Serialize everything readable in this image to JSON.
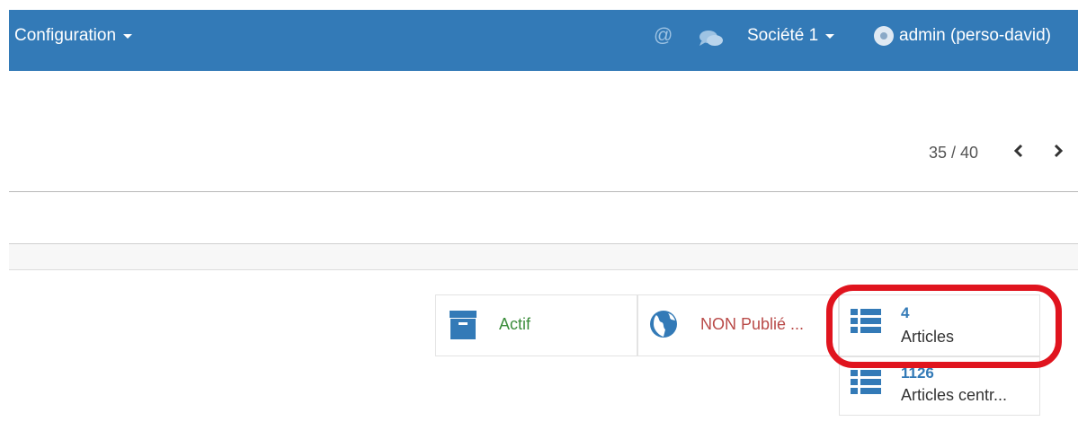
{
  "topbar": {
    "menu_label": "Configuration",
    "mentions_symbol": "@",
    "company_label": "Société 1",
    "user_label": "admin (perso-david)"
  },
  "pager": {
    "text": "35 / 40",
    "prev": "‹",
    "next": "›"
  },
  "buttons": {
    "active": {
      "label": "Actif",
      "color": "#3c8d3c"
    },
    "published": {
      "label": "NON Publié ...",
      "color": "#b94a48"
    },
    "articles": {
      "count": "4",
      "label": "Articles"
    },
    "central_articles": {
      "count": "1126",
      "label": "Articles centr..."
    }
  },
  "colors": {
    "navbar": "#337ab7",
    "icon_blue": "#337ab7",
    "highlight": "#e0141e"
  }
}
